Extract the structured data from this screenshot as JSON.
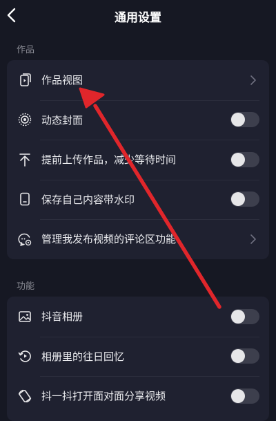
{
  "header": {
    "title": "通用设置"
  },
  "sections": [
    {
      "label": "作品",
      "items": [
        {
          "label": "作品视图",
          "control": "chevron",
          "icon": "works-view-icon"
        },
        {
          "label": "动态封面",
          "control": "toggle",
          "on": false,
          "icon": "dynamic-cover-icon"
        },
        {
          "label": "提前上传作品，减少等待时间",
          "control": "toggle",
          "on": false,
          "icon": "upload-arrow-icon"
        },
        {
          "label": "保存自己内容带水印",
          "control": "toggle",
          "on": false,
          "icon": "phone-watermark-icon"
        },
        {
          "label": "管理我发布视频的评论区功能",
          "control": "chevron",
          "icon": "comment-settings-icon"
        }
      ]
    },
    {
      "label": "功能",
      "items": [
        {
          "label": "抖音相册",
          "control": "toggle",
          "on": false,
          "icon": "album-icon"
        },
        {
          "label": "相册里的往日回忆",
          "control": "toggle",
          "on": false,
          "icon": "memories-icon"
        },
        {
          "label": "抖一抖打开面对面分享视频",
          "control": "toggle",
          "on": false,
          "icon": "shake-share-icon"
        }
      ]
    }
  ],
  "annotation": {
    "type": "arrow",
    "color": "#e0262b",
    "points_to": "作品视图"
  }
}
